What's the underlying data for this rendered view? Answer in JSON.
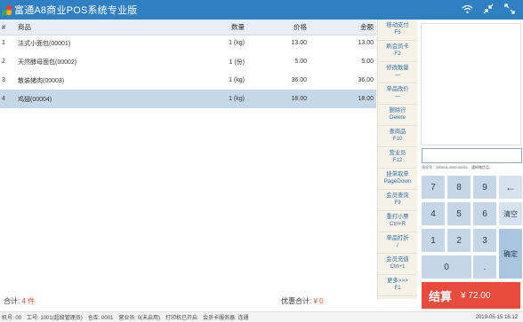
{
  "app": {
    "title": "富通A8商业POS系统专业版"
  },
  "title_icons": [
    "wifi-icon",
    "minimize-arrows-icon",
    "expand-arrows-icon"
  ],
  "table": {
    "headers": {
      "no": "#",
      "name": "商品",
      "qty": "数量",
      "price": "价格",
      "amount": "金额"
    },
    "rows": [
      {
        "no": "1",
        "name": "法式小面包(00001)",
        "qty": "1 (kg)",
        "price": "13.00",
        "amount": "13.00",
        "selected": false
      },
      {
        "no": "2",
        "name": "天然酵母面包(00002)",
        "qty": "1 (份)",
        "price": "5.00",
        "amount": "5.00",
        "selected": false
      },
      {
        "no": "3",
        "name": "散装猪肉(00003)",
        "qty": "1 (kg)",
        "price": "36.00",
        "amount": "36.00",
        "selected": false
      },
      {
        "no": "4",
        "name": "鸡翅(00004)",
        "qty": "1 (kg)",
        "price": "18.00",
        "amount": "18.00",
        "selected": true
      }
    ]
  },
  "totals": {
    "total_label": "合计:",
    "total_value": "4 件",
    "discount_label": "优惠合计:",
    "discount_value": "¥ 0"
  },
  "functions": [
    {
      "label": "移动支付",
      "key": "F5"
    },
    {
      "label": "刷会员卡",
      "key": "F2"
    },
    {
      "label": "修改数量",
      "key": "—"
    },
    {
      "label": "单品改价",
      "key": "—"
    },
    {
      "label": "删除行",
      "key": "Delete"
    },
    {
      "label": "查商品",
      "key": "F10"
    },
    {
      "label": "营业员",
      "key": "F12"
    },
    {
      "label": "挂单取单",
      "key": "PageDown"
    },
    {
      "label": "会员查询",
      "key": "F9"
    },
    {
      "label": "重打小票",
      "key": "Ctrl+R"
    },
    {
      "label": "单品打折",
      "key": "/"
    },
    {
      "label": "会员充值",
      "key": "Ctrl+1"
    },
    {
      "label": "更多>>>",
      "key": "F1"
    }
  ],
  "search": {
    "value": ""
  },
  "serial_info": "流水号：190518-0000-00001　通知微信品...",
  "keypad": {
    "k7": "7",
    "k8": "8",
    "k9": "9",
    "backspace": "←",
    "k4": "4",
    "k5": "5",
    "k6": "6",
    "clear": "清空",
    "k1": "1",
    "k2": "2",
    "k3": "3",
    "confirm": "确定",
    "k0": "0",
    "dot": "."
  },
  "checkout": {
    "label": "结算",
    "amount": "¥ 72.00"
  },
  "status": {
    "left": "机号: 00　工号: 1001(超级管理员)　仓库: 0001　营业员: 0(未启用)　打印机已开启　会员卡服务器: 连通",
    "right": "2019-05-15 16:12"
  }
}
